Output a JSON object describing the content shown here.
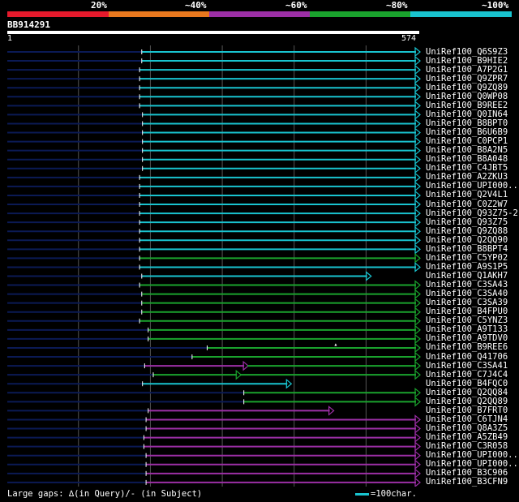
{
  "colors": {
    "background": "#000000",
    "unaligned": "#0b1a55",
    "grid": "#555555",
    "pct20": "#e51a2c",
    "pct40": "#e8781e",
    "pct60": "#9c2fa6",
    "pct80": "#1aa32d",
    "pct100": "#19c3cf"
  },
  "scale": {
    "labels": [
      "20%",
      "~40%",
      "~60%",
      "~80%",
      "~100%"
    ]
  },
  "query": {
    "id": "BB914291",
    "start": "1",
    "end": "574",
    "length": 574
  },
  "hits": [
    {
      "name": "UniRef100_Q6S9Z3",
      "start": 188,
      "end": 574,
      "class": "pct100"
    },
    {
      "name": "UniRef100_B9HIE2",
      "start": 188,
      "end": 574,
      "class": "pct100"
    },
    {
      "name": "UniRef100_A7P2G1",
      "start": 185,
      "end": 574,
      "class": "pct100"
    },
    {
      "name": "UniRef100_Q9ZPR7",
      "start": 185,
      "end": 574,
      "class": "pct100"
    },
    {
      "name": "UniRef100_Q9ZQ89",
      "start": 185,
      "end": 574,
      "class": "pct100"
    },
    {
      "name": "UniRef100_Q0WP08",
      "start": 185,
      "end": 574,
      "class": "pct100"
    },
    {
      "name": "UniRef100_B9REE2",
      "start": 185,
      "end": 574,
      "class": "pct100"
    },
    {
      "name": "UniRef100_Q0IN64",
      "start": 189,
      "end": 574,
      "class": "pct100"
    },
    {
      "name": "UniRef100_B8BPT0",
      "start": 189,
      "end": 574,
      "class": "pct100"
    },
    {
      "name": "UniRef100_B6U6B9",
      "start": 189,
      "end": 574,
      "class": "pct100"
    },
    {
      "name": "UniRef100_C0PCP1",
      "start": 189,
      "end": 574,
      "class": "pct100"
    },
    {
      "name": "UniRef100_B8A2N5",
      "start": 189,
      "end": 574,
      "class": "pct100"
    },
    {
      "name": "UniRef100_B8A048",
      "start": 189,
      "end": 574,
      "class": "pct100"
    },
    {
      "name": "UniRef100_C4JBT5",
      "start": 189,
      "end": 574,
      "class": "pct100"
    },
    {
      "name": "UniRef100_A2ZKU3",
      "start": 185,
      "end": 574,
      "class": "pct100"
    },
    {
      "name": "UniRef100_UPI000..",
      "start": 185,
      "end": 574,
      "class": "pct100"
    },
    {
      "name": "UniRef100_Q2V4L1",
      "start": 185,
      "end": 574,
      "class": "pct100"
    },
    {
      "name": "UniRef100_C0Z2W7",
      "start": 185,
      "end": 574,
      "class": "pct100"
    },
    {
      "name": "UniRef100_Q93Z75-2",
      "start": 185,
      "end": 574,
      "class": "pct100"
    },
    {
      "name": "UniRef100_Q93Z75",
      "start": 185,
      "end": 574,
      "class": "pct100"
    },
    {
      "name": "UniRef100_Q9ZQ88",
      "start": 185,
      "end": 574,
      "class": "pct100"
    },
    {
      "name": "UniRef100_Q2QQ90",
      "start": 185,
      "end": 574,
      "class": "pct100"
    },
    {
      "name": "UniRef100_B8BPT4",
      "start": 185,
      "end": 574,
      "class": "pct100"
    },
    {
      "name": "UniRef100_C5YP02",
      "start": 185,
      "end": 574,
      "class": "pct80"
    },
    {
      "name": "UniRef100_A9S1P5",
      "start": 185,
      "end": 574,
      "class": "pct100"
    },
    {
      "name": "UniRef100_Q1AKH7",
      "start": 188,
      "end": 506,
      "class": "pct100"
    },
    {
      "name": "UniRef100_C3SA43",
      "start": 185,
      "end": 574,
      "class": "pct80"
    },
    {
      "name": "UniRef100_C3SA40",
      "start": 188,
      "end": 574,
      "class": "pct80"
    },
    {
      "name": "UniRef100_C3SA39",
      "start": 188,
      "end": 574,
      "class": "pct80"
    },
    {
      "name": "UniRef100_B4FPU0",
      "start": 188,
      "end": 574,
      "class": "pct80"
    },
    {
      "name": "UniRef100_C5YNZ3",
      "start": 185,
      "end": 574,
      "class": "pct80"
    },
    {
      "name": "UniRef100_A9T133",
      "start": 197,
      "end": 574,
      "class": "pct80"
    },
    {
      "name": "UniRef100_A9TDV0",
      "start": 197,
      "end": 574,
      "class": "pct80"
    },
    {
      "name": "UniRef100_B9REE6",
      "start": 279,
      "end": 574,
      "class": "pct80"
    },
    {
      "name": "UniRef100_Q41706",
      "start": 258,
      "end": 574,
      "class": "pct80"
    },
    {
      "name": "UniRef100_C3SA41",
      "start": 192,
      "end": 574,
      "class": "pct60",
      "segments": [
        [
          192,
          335,
          "pct60"
        ],
        [
          335,
          574,
          "pct80"
        ]
      ]
    },
    {
      "name": "UniRef100_C7J4C4",
      "start": 204,
      "end": 574,
      "class": "pct80",
      "segments": [
        [
          204,
          325,
          "pct80"
        ],
        [
          325,
          574,
          "pct80"
        ]
      ]
    },
    {
      "name": "UniRef100_B4FQC0",
      "start": 189,
      "end": 395,
      "class": "pct100"
    },
    {
      "name": "UniRef100_Q2QQ84",
      "start": 330,
      "end": 574,
      "class": "pct80"
    },
    {
      "name": "UniRef100_Q2QQ89",
      "start": 330,
      "end": 574,
      "class": "pct80"
    },
    {
      "name": "UniRef100_B7FRT0",
      "start": 197,
      "end": 454,
      "class": "pct60"
    },
    {
      "name": "UniRef100_C6TJN4",
      "start": 194,
      "end": 574,
      "class": "pct60"
    },
    {
      "name": "UniRef100_Q8A3Z5",
      "start": 194,
      "end": 574,
      "class": "pct60"
    },
    {
      "name": "UniRef100_A5ZB49",
      "start": 191,
      "end": 574,
      "class": "pct60"
    },
    {
      "name": "UniRef100_C3R058",
      "start": 191,
      "end": 574,
      "class": "pct60"
    },
    {
      "name": "UniRef100_UPI000..",
      "start": 194,
      "end": 574,
      "class": "pct60"
    },
    {
      "name": "UniRef100_UPI000..",
      "start": 194,
      "end": 574,
      "class": "pct60"
    },
    {
      "name": "UniRef100_B3C906",
      "start": 194,
      "end": 574,
      "class": "pct60"
    },
    {
      "name": "UniRef100_B3CFN9",
      "start": 194,
      "end": 574,
      "class": "pct60"
    }
  ],
  "legend": {
    "gaps_text": "Large gaps: ∆(in Query)/- (in Subject)",
    "scale_text": "=100char."
  }
}
